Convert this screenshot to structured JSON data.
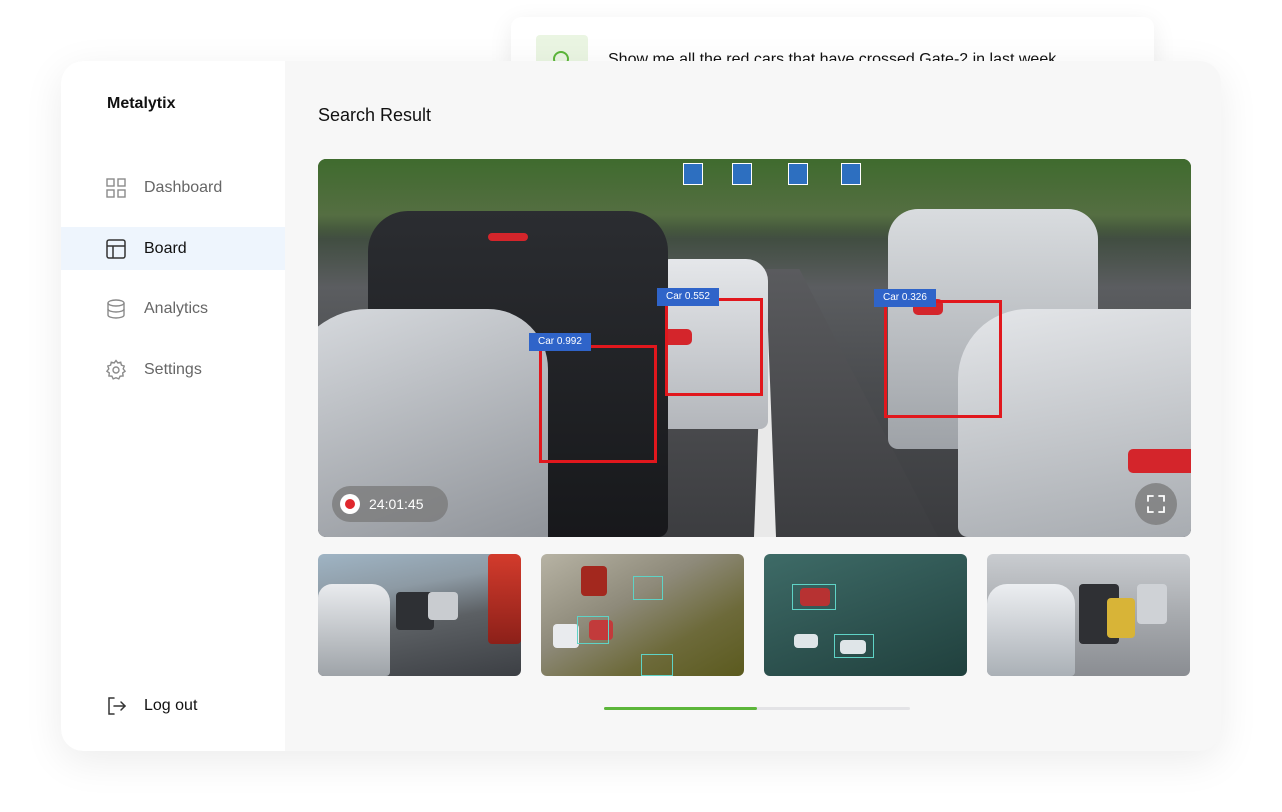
{
  "app": {
    "brand": "Metalytix"
  },
  "sidebar": {
    "items": [
      {
        "label": "Dashboard",
        "icon": "grid-icon",
        "active": false
      },
      {
        "label": "Board",
        "icon": "layout-icon",
        "active": true
      },
      {
        "label": "Analytics",
        "icon": "database-icon",
        "active": false
      },
      {
        "label": "Settings",
        "icon": "gear-icon",
        "active": false
      }
    ],
    "logout_label": "Log out"
  },
  "search": {
    "query": "Show me all the red cars that have crossed Gate-2 in last week"
  },
  "main": {
    "title": "Search Result",
    "video": {
      "timestamp": "24:01:45",
      "detections": [
        {
          "label": "Car 0.992"
        },
        {
          "label": "Car 0.552"
        },
        {
          "label": "Car 0.326"
        }
      ]
    },
    "thumbnails_count": 4,
    "carousel_progress": 0.5
  },
  "colors": {
    "accent_green": "#5cb63a",
    "active_bg": "#eef5fd",
    "detection_box": "#e1171d",
    "detection_label": "#2f64c9"
  }
}
